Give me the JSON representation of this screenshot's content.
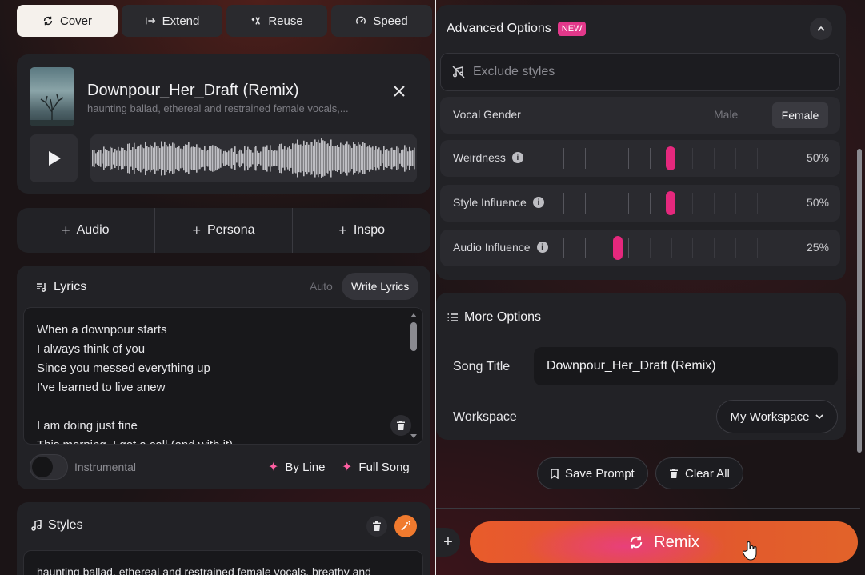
{
  "tabs": [
    {
      "label": "Cover",
      "icon": "cover-icon",
      "active": true
    },
    {
      "label": "Extend",
      "icon": "extend-icon",
      "active": false
    },
    {
      "label": "Reuse",
      "icon": "reuse-icon",
      "active": false
    },
    {
      "label": "Speed",
      "icon": "speed-icon",
      "active": false
    }
  ],
  "song": {
    "title": "Downpour_Her_Draft (Remix)",
    "subtitle": "haunting ballad, ethereal and restrained female vocals,..."
  },
  "add_buttons": [
    "Audio",
    "Persona",
    "Inspo"
  ],
  "lyrics": {
    "heading": "Lyrics",
    "mode_auto": "Auto",
    "mode_write": "Write Lyrics",
    "lines": [
      "When a downpour starts",
      "I always think of you",
      "Since you messed everything up",
      "I've learned to live anew",
      "",
      "I am doing just fine",
      "This morning, I got a call (and with it)"
    ],
    "instrumental_label": "Instrumental",
    "instrumental_on": false,
    "by_line": "By Line",
    "full_song": "Full Song"
  },
  "styles": {
    "heading": "Styles",
    "text": "haunting ballad, ethereal and restrained female vocals, breathy and"
  },
  "advanced": {
    "title": "Advanced Options",
    "badge": "NEW",
    "exclude_placeholder": "Exclude styles",
    "vocal_gender_label": "Vocal Gender",
    "gender_male": "Male",
    "gender_female": "Female",
    "gender_selected": "Female",
    "sliders": [
      {
        "label": "Weirdness",
        "value_text": "50%",
        "value": 0.5
      },
      {
        "label": "Style Influence",
        "value_text": "50%",
        "value": 0.5
      },
      {
        "label": "Audio Influence",
        "value_text": "25%",
        "value": 0.25
      }
    ]
  },
  "more": {
    "title": "More Options",
    "song_title_label": "Song Title",
    "song_title_value": "Downpour_Her_Draft (Remix)",
    "workspace_label": "Workspace",
    "workspace_value": "My Workspace"
  },
  "actions": {
    "save_prompt": "Save Prompt",
    "clear_all": "Clear All",
    "remix": "Remix"
  },
  "colors": {
    "accent_pink": "#e5287d",
    "remix_orange": "#e85c2a",
    "new_badge": "#e2388a"
  }
}
